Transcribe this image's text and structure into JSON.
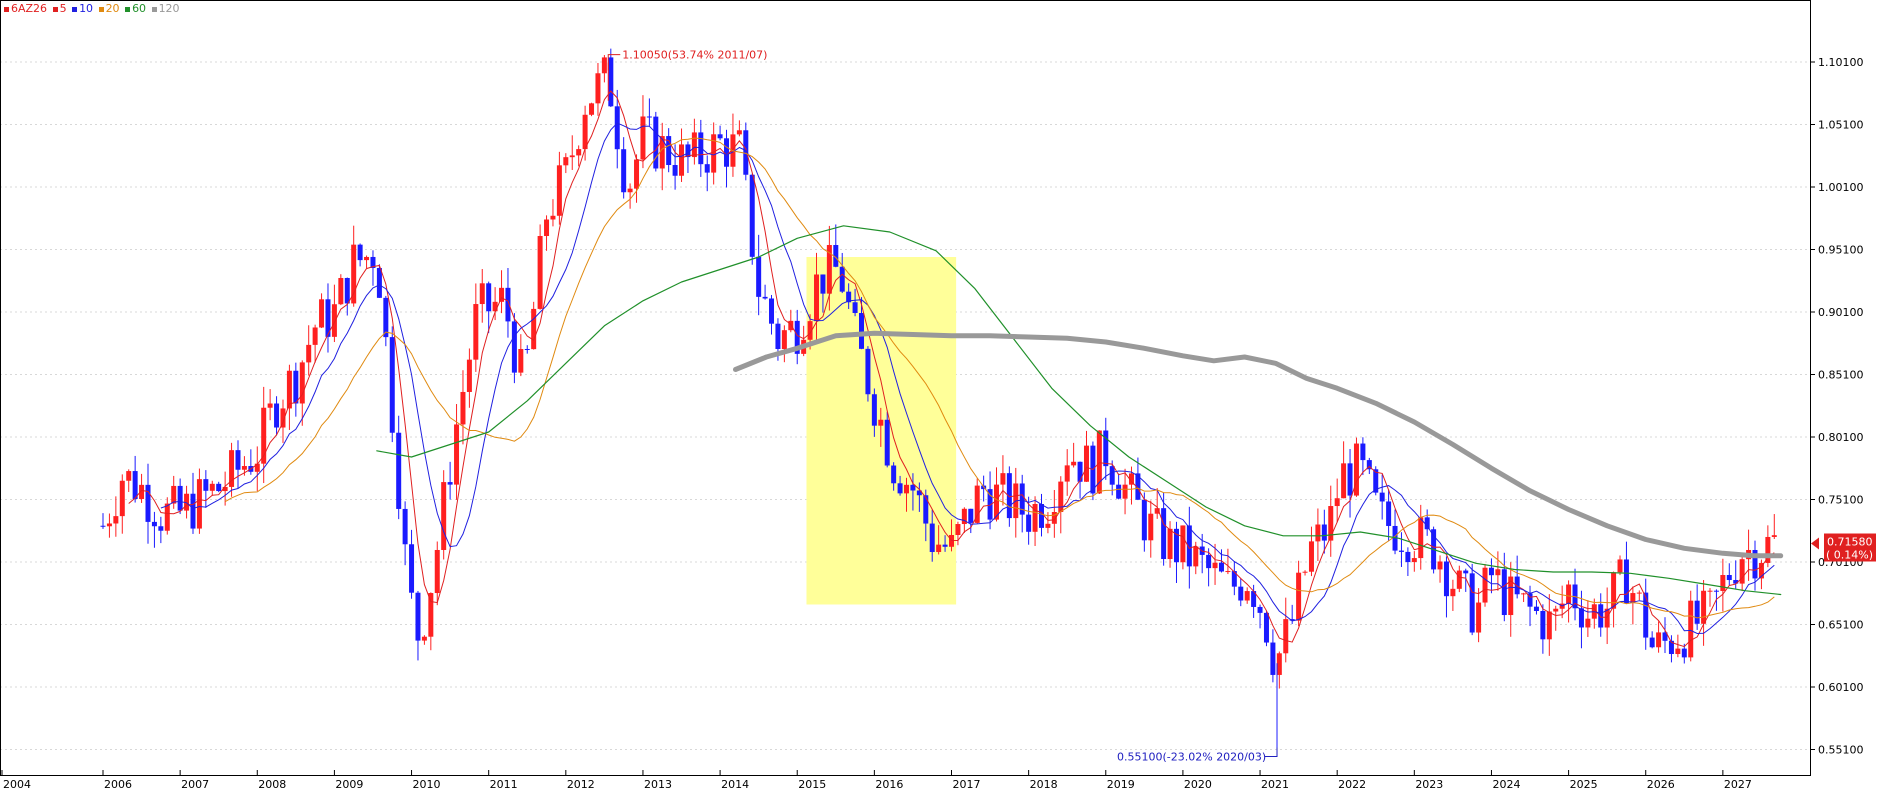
{
  "legend": {
    "symbol": "6AZ26",
    "ma": [
      {
        "period": "5",
        "color": "#e02020"
      },
      {
        "period": "10",
        "color": "#2020e0"
      },
      {
        "period": "20",
        "color": "#e08a10"
      },
      {
        "period": "60",
        "color": "#20902a"
      },
      {
        "period": "120",
        "color": "#999999"
      }
    ]
  },
  "annotations": {
    "high": "1.10050(53.74% 2011/07)",
    "low": "0.55100(-23.02% 2020/03)"
  },
  "price_label": {
    "value": "0.71580",
    "change": "( 0.14%)"
  },
  "colors": {
    "up": "#ff2020",
    "down": "#1a1aff",
    "highlight": "#ffff99"
  },
  "chart_data": {
    "type": "candlestick",
    "x_ticks": [
      "2004",
      "2006",
      "2007",
      "2008",
      "2009",
      "2010",
      "2011",
      "2012",
      "2013",
      "2014",
      "2015",
      "2016",
      "2017",
      "2018",
      "2019",
      "2020",
      "2021",
      "2022",
      "2023",
      "2024",
      "2025",
      "2026",
      "2027"
    ],
    "y_ticks": [
      "0.55100",
      "0.60100",
      "0.65100",
      "0.70100",
      "0.75100",
      "0.80100",
      "0.85100",
      "0.90100",
      "0.95100",
      "1.00100",
      "1.05100",
      "1.10100"
    ],
    "ylim": [
      0.545,
      1.125
    ],
    "xlim": [
      2005.0,
      2027.0
    ],
    "close_series": [
      [
        2005.0,
        0.73
      ],
      [
        2005.25,
        0.77
      ],
      [
        2005.5,
        0.76
      ],
      [
        2005.75,
        0.74
      ],
      [
        2006.0,
        0.74
      ],
      [
        2006.25,
        0.75
      ],
      [
        2006.5,
        0.76
      ],
      [
        2006.75,
        0.775
      ],
      [
        2007.0,
        0.79
      ],
      [
        2007.25,
        0.83
      ],
      [
        2007.5,
        0.85
      ],
      [
        2007.75,
        0.89
      ],
      [
        2008.0,
        0.9
      ],
      [
        2008.25,
        0.94
      ],
      [
        2008.55,
        0.95
      ],
      [
        2008.8,
        0.79
      ],
      [
        2008.95,
        0.68
      ],
      [
        2009.1,
        0.64
      ],
      [
        2009.3,
        0.7
      ],
      [
        2009.55,
        0.8
      ],
      [
        2009.85,
        0.9
      ],
      [
        2010.2,
        0.91
      ],
      [
        2010.45,
        0.84
      ],
      [
        2010.75,
        0.98
      ],
      [
        2011.0,
        1.01
      ],
      [
        2011.25,
        1.07
      ],
      [
        2011.55,
        1.09
      ],
      [
        2011.8,
        1.0
      ],
      [
        2012.0,
        1.04
      ],
      [
        2012.3,
        1.03
      ],
      [
        2012.55,
        1.02
      ],
      [
        2012.85,
        1.03
      ],
      [
        2013.0,
        1.035
      ],
      [
        2013.25,
        1.03
      ],
      [
        2013.5,
        0.92
      ],
      [
        2013.75,
        0.88
      ],
      [
        2014.0,
        0.89
      ],
      [
        2014.3,
        0.93
      ],
      [
        2014.55,
        0.935
      ],
      [
        2014.75,
        0.88
      ],
      [
        2015.0,
        0.83
      ],
      [
        2015.25,
        0.78
      ],
      [
        2015.5,
        0.76
      ],
      [
        2015.75,
        0.72
      ],
      [
        2016.0,
        0.71
      ],
      [
        2016.15,
        0.73
      ],
      [
        2016.4,
        0.76
      ],
      [
        2016.7,
        0.75
      ],
      [
        2017.0,
        0.74
      ],
      [
        2017.25,
        0.75
      ],
      [
        2017.5,
        0.79
      ],
      [
        2017.8,
        0.775
      ],
      [
        2018.0,
        0.79
      ],
      [
        2018.25,
        0.76
      ],
      [
        2018.55,
        0.73
      ],
      [
        2018.8,
        0.715
      ],
      [
        2019.0,
        0.71
      ],
      [
        2019.3,
        0.695
      ],
      [
        2019.6,
        0.68
      ],
      [
        2019.85,
        0.69
      ],
      [
        2020.05,
        0.66
      ],
      [
        2020.2,
        0.62
      ],
      [
        2020.4,
        0.65
      ],
      [
        2020.65,
        0.71
      ],
      [
        2020.9,
        0.73
      ],
      [
        2021.05,
        0.77
      ],
      [
        2021.3,
        0.775
      ],
      [
        2021.55,
        0.735
      ],
      [
        2021.85,
        0.725
      ],
      [
        2022.05,
        0.72
      ],
      [
        2022.3,
        0.71
      ],
      [
        2022.55,
        0.68
      ],
      [
        2022.8,
        0.66
      ],
      [
        2023.0,
        0.69
      ],
      [
        2023.25,
        0.67
      ],
      [
        2023.55,
        0.66
      ],
      [
        2023.8,
        0.65
      ],
      [
        2024.0,
        0.68
      ],
      [
        2024.25,
        0.66
      ],
      [
        2024.5,
        0.665
      ],
      [
        2024.75,
        0.69
      ],
      [
        2024.95,
        0.66
      ],
      [
        2025.1,
        0.63
      ],
      [
        2025.35,
        0.64
      ],
      [
        2025.6,
        0.65
      ],
      [
        2025.85,
        0.66
      ],
      [
        2026.05,
        0.69
      ],
      [
        2026.25,
        0.71
      ],
      [
        2026.45,
        0.71
      ],
      [
        2026.65,
        0.716
      ]
    ],
    "moving_averages": [
      {
        "period": "60",
        "points": [
          [
            2008.55,
            0.79
          ],
          [
            2009.0,
            0.785
          ],
          [
            2009.5,
            0.795
          ],
          [
            2010.0,
            0.805
          ],
          [
            2010.5,
            0.83
          ],
          [
            2011.0,
            0.86
          ],
          [
            2011.5,
            0.89
          ],
          [
            2012.0,
            0.91
          ],
          [
            2012.5,
            0.925
          ],
          [
            2013.0,
            0.935
          ],
          [
            2013.5,
            0.945
          ],
          [
            2014.0,
            0.96
          ],
          [
            2014.6,
            0.97
          ],
          [
            2015.2,
            0.965
          ],
          [
            2015.8,
            0.95
          ],
          [
            2016.3,
            0.92
          ],
          [
            2016.8,
            0.88
          ],
          [
            2017.3,
            0.84
          ],
          [
            2017.8,
            0.81
          ],
          [
            2018.3,
            0.785
          ],
          [
            2018.8,
            0.765
          ],
          [
            2019.3,
            0.745
          ],
          [
            2019.8,
            0.73
          ],
          [
            2020.3,
            0.722
          ],
          [
            2020.8,
            0.722
          ],
          [
            2021.3,
            0.725
          ],
          [
            2021.8,
            0.72
          ],
          [
            2022.3,
            0.71
          ],
          [
            2022.8,
            0.7
          ],
          [
            2023.3,
            0.695
          ],
          [
            2023.8,
            0.693
          ],
          [
            2024.3,
            0.693
          ],
          [
            2024.8,
            0.692
          ],
          [
            2025.3,
            0.688
          ],
          [
            2025.8,
            0.683
          ],
          [
            2026.3,
            0.678
          ],
          [
            2026.75,
            0.675
          ]
        ]
      },
      {
        "period": "120",
        "points": [
          [
            2013.2,
            0.855
          ],
          [
            2013.6,
            0.865
          ],
          [
            2014.0,
            0.872
          ],
          [
            2014.5,
            0.882
          ],
          [
            2015.0,
            0.884
          ],
          [
            2015.5,
            0.883
          ],
          [
            2016.0,
            0.882
          ],
          [
            2016.5,
            0.882
          ],
          [
            2017.0,
            0.881
          ],
          [
            2017.5,
            0.88
          ],
          [
            2018.0,
            0.877
          ],
          [
            2018.5,
            0.872
          ],
          [
            2019.0,
            0.866
          ],
          [
            2019.4,
            0.862
          ],
          [
            2019.8,
            0.865
          ],
          [
            2020.2,
            0.86
          ],
          [
            2020.6,
            0.848
          ],
          [
            2021.0,
            0.84
          ],
          [
            2021.5,
            0.828
          ],
          [
            2022.0,
            0.813
          ],
          [
            2022.5,
            0.795
          ],
          [
            2023.0,
            0.776
          ],
          [
            2023.5,
            0.758
          ],
          [
            2024.0,
            0.743
          ],
          [
            2024.5,
            0.73
          ],
          [
            2025.0,
            0.719
          ],
          [
            2025.5,
            0.712
          ],
          [
            2026.0,
            0.708
          ],
          [
            2026.4,
            0.706
          ],
          [
            2026.75,
            0.706
          ]
        ]
      }
    ]
  }
}
